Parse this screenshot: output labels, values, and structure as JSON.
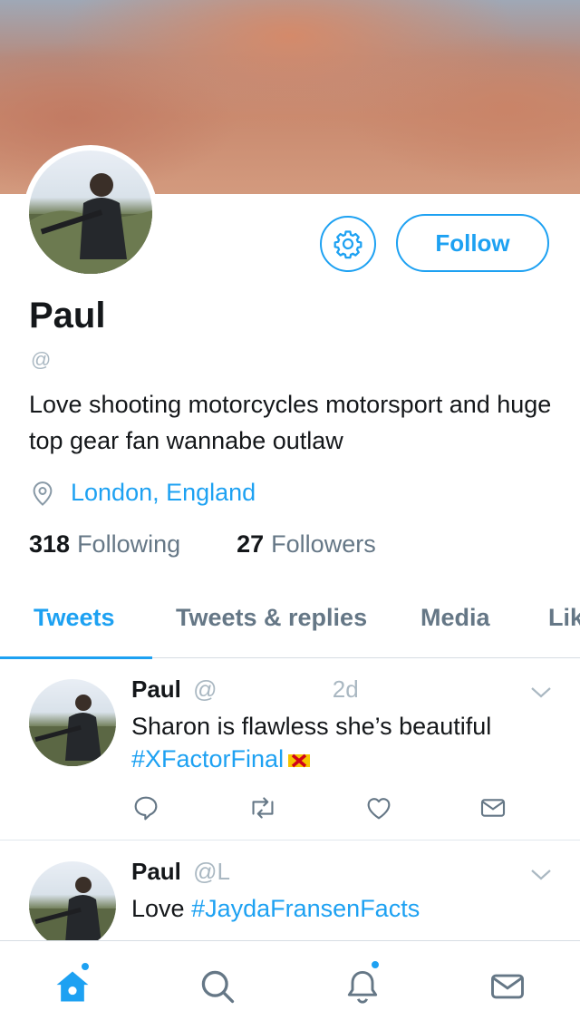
{
  "profile": {
    "name": "Paul",
    "handle": "@",
    "bio": "Love shooting motorcycles motorsport and huge top gear fan wannabe outlaw",
    "location": "London, England",
    "following_count": "318",
    "following_label": "Following",
    "followers_count": "27",
    "followers_label": "Followers",
    "follow_label": "Follow"
  },
  "tabs": [
    {
      "label": "Tweets",
      "active": true
    },
    {
      "label": "Tweets & replies",
      "active": false
    },
    {
      "label": "Media",
      "active": false
    },
    {
      "label": "Lik",
      "active": false
    }
  ],
  "tweets": [
    {
      "name": "Paul",
      "handle": "@",
      "meta": "2d",
      "text": "Sharon is flawless she’s beautiful",
      "hashtag": "#XFactorFinal"
    },
    {
      "name": "Paul",
      "handle": "@L",
      "text": "Love",
      "hashtag": "#JaydaFransenFacts"
    }
  ],
  "colors": {
    "accent": "#1da1f2",
    "text": "#14171a",
    "muted": "#657786"
  },
  "icons": {
    "settings": "gear-icon",
    "location": "location-pin-icon",
    "reply": "reply-icon",
    "retweet": "retweet-icon",
    "like": "heart-icon",
    "dm": "envelope-icon",
    "chevron": "chevron-down-icon",
    "home": "home-icon",
    "search": "search-icon",
    "notifications": "bell-icon",
    "messages": "envelope-icon"
  }
}
